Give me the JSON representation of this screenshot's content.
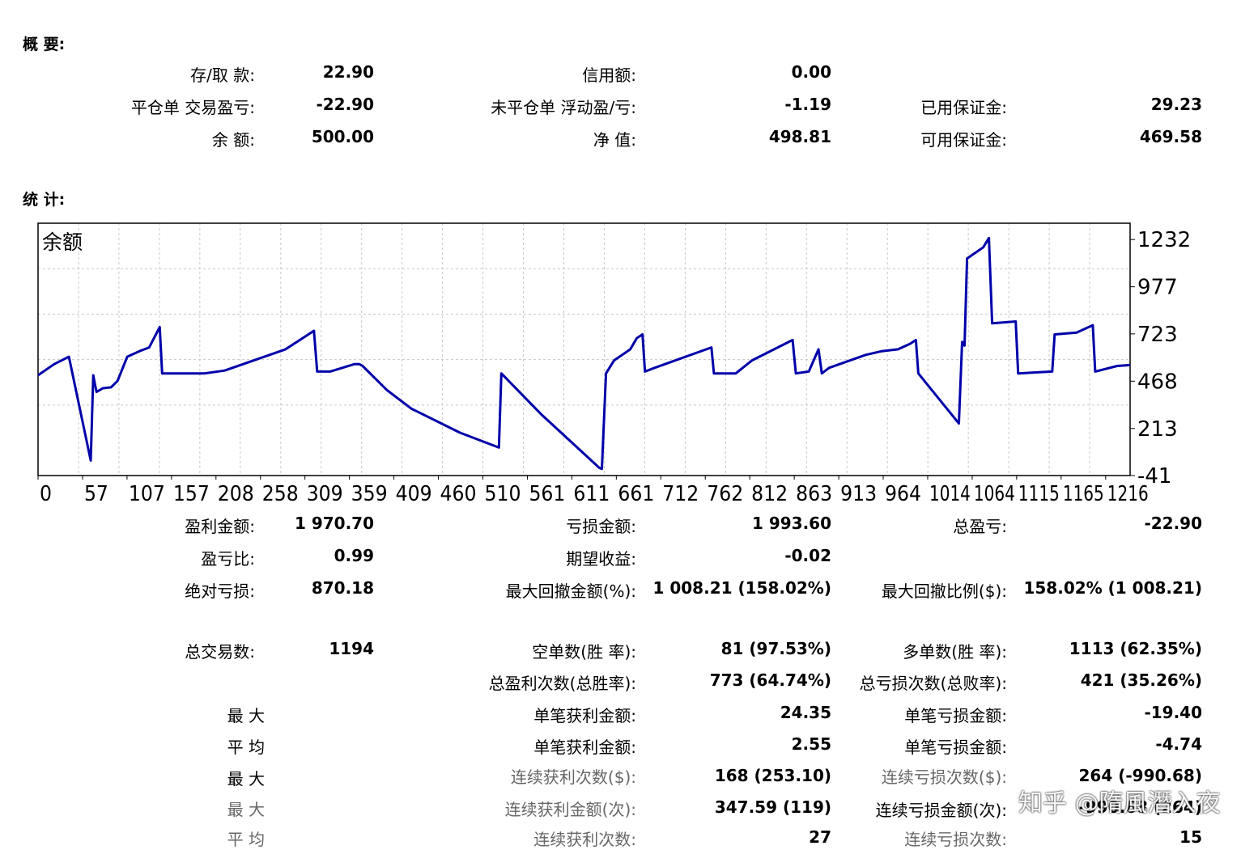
{
  "summary": {
    "title": "概 要:",
    "rows": [
      {
        "l1": "存/取 款:",
        "v1": "22.90",
        "l2": "信用额:",
        "v2": "0.00",
        "l3": "",
        "v3": ""
      },
      {
        "l1": "平仓单 交易盈亏:",
        "v1": "-22.90",
        "l2": "未平仓单 浮动盈/亏:",
        "v2": "-1.19",
        "l3": "已用保证金:",
        "v3": "29.23"
      },
      {
        "l1": "余 额:",
        "v1": "500.00",
        "l2": "净 值:",
        "v2": "498.81",
        "l3": "可用保证金:",
        "v3": "469.58"
      }
    ]
  },
  "stats_title": "统 计:",
  "chart_data": {
    "type": "line",
    "title": "余额",
    "series": [
      {
        "color": "#0000aa",
        "points": [
          [
            0,
            500
          ],
          [
            20,
            560
          ],
          [
            38,
            600
          ],
          [
            65,
            40
          ],
          [
            68,
            500
          ],
          [
            72,
            410
          ],
          [
            80,
            430
          ],
          [
            90,
            435
          ],
          [
            98,
            470
          ],
          [
            110,
            600
          ],
          [
            125,
            630
          ],
          [
            137,
            650
          ],
          [
            150,
            760
          ],
          [
            153,
            510
          ],
          [
            205,
            510
          ],
          [
            230,
            525
          ],
          [
            305,
            640
          ],
          [
            340,
            740
          ],
          [
            344,
            520
          ],
          [
            360,
            520
          ],
          [
            390,
            560
          ],
          [
            396,
            560
          ],
          [
            400,
            550
          ],
          [
            430,
            420
          ],
          [
            460,
            320
          ],
          [
            520,
            190
          ],
          [
            568,
            110
          ],
          [
            571,
            510
          ],
          [
            620,
            290
          ],
          [
            692,
            0
          ],
          [
            695,
            -5
          ],
          [
            700,
            510
          ],
          [
            710,
            580
          ],
          [
            730,
            640
          ],
          [
            738,
            700
          ],
          [
            745,
            720
          ],
          [
            748,
            520
          ],
          [
            760,
            540
          ],
          [
            830,
            650
          ],
          [
            833,
            510
          ],
          [
            860,
            510
          ],
          [
            880,
            580
          ],
          [
            930,
            690
          ],
          [
            934,
            510
          ],
          [
            950,
            520
          ],
          [
            962,
            640
          ],
          [
            966,
            510
          ],
          [
            975,
            540
          ],
          [
            1020,
            610
          ],
          [
            1040,
            630
          ],
          [
            1060,
            640
          ],
          [
            1075,
            670
          ],
          [
            1082,
            690
          ],
          [
            1085,
            510
          ],
          [
            1135,
            240
          ],
          [
            1139,
            680
          ],
          [
            1142,
            660
          ],
          [
            1145,
            1130
          ],
          [
            1165,
            1190
          ],
          [
            1172,
            1240
          ],
          [
            1176,
            780
          ],
          [
            1205,
            790
          ],
          [
            1208,
            510
          ],
          [
            1250,
            520
          ],
          [
            1253,
            720
          ],
          [
            1280,
            730
          ],
          [
            1300,
            770
          ],
          [
            1303,
            520
          ],
          [
            1330,
            550
          ],
          [
            1346,
            555
          ]
        ]
      }
    ],
    "xlim": [
      0,
      1346
    ],
    "ylim": [
      -41,
      1320
    ],
    "y_ticks": [
      -41,
      213,
      468,
      723,
      977,
      1232
    ],
    "x_tick_labels": [
      "0",
      "57",
      "107",
      "157",
      "208",
      "258",
      "309",
      "359",
      "409",
      "460",
      "510",
      "561",
      "611",
      "661",
      "712",
      "762",
      "812",
      "863",
      "913",
      "964",
      "1014",
      "1064",
      "1115",
      "1165",
      "1216"
    ],
    "grid": true,
    "grid_cols": 27,
    "grid_rows": 5
  },
  "stats": {
    "rows": [
      {
        "l1": "盈利金额:",
        "v1": "1 970.70",
        "l2": "亏损金额:",
        "v2": "1 993.60",
        "l3": "总盈亏:",
        "v3": "-22.90"
      },
      {
        "l1": "盈亏比:",
        "v1": "0.99",
        "l2": "期望收益:",
        "v2": "-0.02",
        "l3": "",
        "v3": ""
      },
      {
        "l1": "绝对亏损:",
        "v1": "870.18",
        "l2": "最大回撤金额(%):",
        "v2": "1 008.21 (158.02%)",
        "l3": "最大回撤比例($):",
        "v3": "158.02% (1 008.21)"
      },
      {
        "l1": "总交易数:",
        "v1": "1194",
        "l2": "空单数(胜 率):",
        "v2": "81 (97.53%)",
        "l3": "多单数(胜 率):",
        "v3": "1113 (62.35%)"
      },
      {
        "l1": "",
        "v1": "",
        "l2": "总盈利次数(总胜率):",
        "v2": "773 (64.74%)",
        "l3": "总亏损次数(总败率):",
        "v3": "421 (35.26%)"
      }
    ],
    "detail_rows": [
      {
        "side": "最 大",
        "l2": "单笔获利金额:",
        "v2": "24.35",
        "l3": "单笔亏损金额:",
        "v3": "-19.40"
      },
      {
        "side": "平 均",
        "l2": "单笔获利金额:",
        "v2": "2.55",
        "l3": "单笔亏损金额:",
        "v3": "-4.74"
      },
      {
        "side": "最 大",
        "l2": "连续获利次数($):",
        "v2": "168 (253.10)",
        "l3": "连续亏损次数($):",
        "v3": "264 (-990.68)"
      },
      {
        "side": "最 大",
        "l2": "连续获利金额(次):",
        "v2": "347.59 (119)",
        "l3": "连续亏损金额(次):",
        "v3": "-990.68 (264)"
      },
      {
        "side": "平 均",
        "l2": "连续获利次数:",
        "v2": "27",
        "l3": "连续亏损次数:",
        "v3": "15"
      }
    ]
  },
  "watermark": "知乎 @隋風潛入夜"
}
